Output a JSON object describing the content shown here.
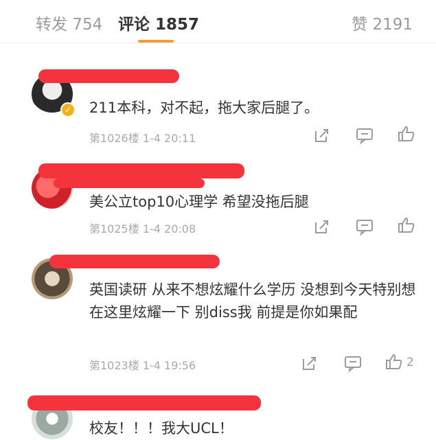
{
  "tabs": {
    "repost_label": "转发",
    "repost_count": "754",
    "comments_label": "评论",
    "comments_count": "1857",
    "likes_label": "赞",
    "likes_count": "2191"
  },
  "comments": [
    {
      "text": "211本科，对不起，拖大家后腿了。",
      "floor": "第1026楼",
      "time": "1-4 20:11",
      "likes": ""
    },
    {
      "text": "美公立top10心理学 希望没拖后腿",
      "floor": "第1025楼",
      "time": "1-4 20:08",
      "likes": ""
    },
    {
      "text": "英国读研 从来不想炫耀什么学历 没想到今天特别想在这里炫耀一下 别diss我 前提是你如果配",
      "floor": "第1023楼",
      "time": "1-4 19:56",
      "likes": "2"
    },
    {
      "text": "校友！！！我大UCL！",
      "floor": "",
      "time": "",
      "likes": ""
    }
  ],
  "icons": {
    "forward": "forward-icon",
    "comment": "comment-icon",
    "like": "thumbs-up-icon",
    "verified": "verified-badge-icon"
  },
  "colors": {
    "accent": "#f59c2a",
    "redaction": "#f4333c",
    "verified": "#f5b11a",
    "meta_text": "#aaaaaa"
  }
}
